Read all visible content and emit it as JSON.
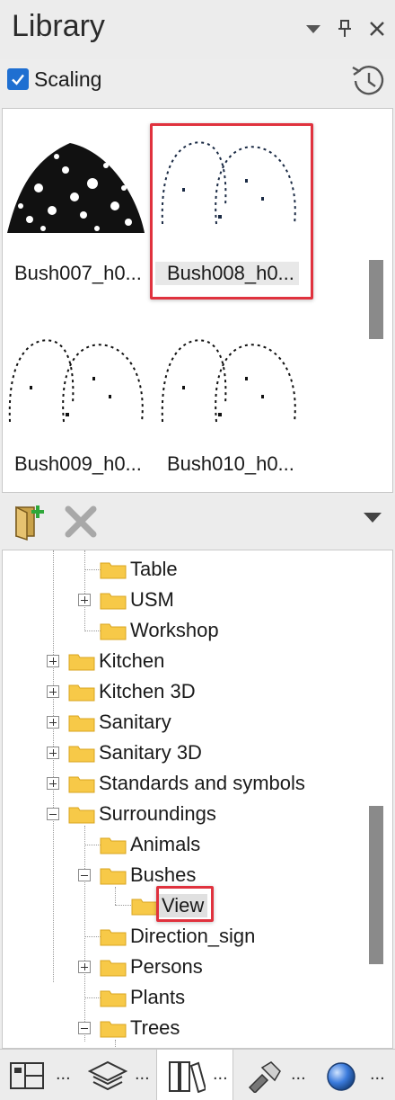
{
  "panel": {
    "title": "Library",
    "menu_icon": "dropdown-triangle-icon",
    "pin_icon": "pin-icon",
    "close_icon": "close-icon"
  },
  "scaling": {
    "label": "Scaling",
    "checked": true,
    "history_icon": "clock-history-icon"
  },
  "thumbnails": [
    {
      "label": "Bush007_h0...",
      "selected": false
    },
    {
      "label": "Bush008_h0...",
      "selected": true
    },
    {
      "label": "Bush009_h0...",
      "selected": false
    },
    {
      "label": "Bush010_h0...",
      "selected": false
    }
  ],
  "toolbar": {
    "add_icon": "add-folder-icon",
    "delete_icon": "delete-x-icon",
    "menu_icon": "dropdown-triangle-icon"
  },
  "tree": [
    {
      "label": "Table",
      "level": 2
    },
    {
      "label": "USM",
      "level": 2,
      "expander": "plus"
    },
    {
      "label": "Workshop",
      "level": 2
    },
    {
      "label": "Kitchen",
      "level": 1,
      "expander": "plus"
    },
    {
      "label": "Kitchen 3D",
      "level": 1,
      "expander": "plus"
    },
    {
      "label": "Sanitary",
      "level": 1,
      "expander": "plus"
    },
    {
      "label": "Sanitary 3D",
      "level": 1,
      "expander": "plus"
    },
    {
      "label": "Standards and symbols",
      "level": 1,
      "expander": "plus"
    },
    {
      "label": "Surroundings",
      "level": 1,
      "expander": "minus"
    },
    {
      "label": "Animals",
      "level": 2
    },
    {
      "label": "Bushes",
      "level": 2,
      "expander": "minus"
    },
    {
      "label": "View",
      "level": 3,
      "selected": true
    },
    {
      "label": "Direction_sign",
      "level": 2
    },
    {
      "label": "Persons",
      "level": 2,
      "expander": "plus"
    },
    {
      "label": "Plants",
      "level": 2
    },
    {
      "label": "Trees",
      "level": 2,
      "expander": "minus"
    }
  ],
  "bottom_tabs": [
    {
      "icon": "layout-panels-icon",
      "more": "...",
      "active": false
    },
    {
      "icon": "layers-icon",
      "more": "...",
      "active": false
    },
    {
      "icon": "library-books-icon",
      "more": "...",
      "active": true
    },
    {
      "icon": "tools-icon",
      "more": "...",
      "active": false
    },
    {
      "icon": "globe-sphere-icon",
      "more": "...",
      "active": false
    }
  ],
  "colors": {
    "accent": "#1f6fd1",
    "highlight": "#e0323e",
    "folder": "#f7c948"
  }
}
